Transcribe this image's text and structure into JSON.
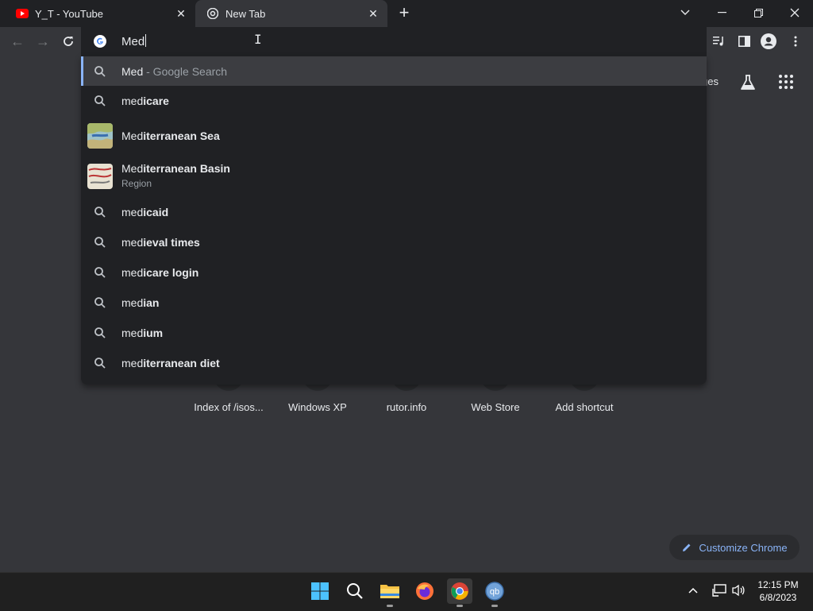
{
  "tabs": [
    {
      "title": "Y_T - YouTube",
      "icon": "youtube-icon"
    },
    {
      "title": "New Tab",
      "icon": "chrome-icon"
    }
  ],
  "omnibox": {
    "value": "Med"
  },
  "dropdown": {
    "top": {
      "match": "Med",
      "hint": " - Google Search"
    },
    "items": [
      {
        "prefix": "med",
        "suffix": "icare",
        "sub": "",
        "icon": "search-icon"
      },
      {
        "prefix": "Med",
        "suffix": "iterranean Sea",
        "sub": "",
        "icon": "map-thumbnail"
      },
      {
        "prefix": "Med",
        "suffix": "iterranean Basin",
        "sub": "Region",
        "icon": "map-thumbnail"
      },
      {
        "prefix": "med",
        "suffix": "icaid",
        "sub": "",
        "icon": "search-icon"
      },
      {
        "prefix": "med",
        "suffix": "ieval times",
        "sub": "",
        "icon": "search-icon"
      },
      {
        "prefix": "med",
        "suffix": "icare login",
        "sub": "",
        "icon": "search-icon"
      },
      {
        "prefix": "med",
        "suffix": "ian",
        "sub": "",
        "icon": "search-icon"
      },
      {
        "prefix": "med",
        "suffix": "ium",
        "sub": "",
        "icon": "search-icon"
      },
      {
        "prefix": "med",
        "suffix": "iterranean diet",
        "sub": "",
        "icon": "search-icon"
      }
    ]
  },
  "page": {
    "images_label_partial": "ges",
    "shortcuts": [
      "Index of /isos...",
      "Windows XP",
      "rutor.info",
      "Web Store",
      "Add shortcut"
    ],
    "customize_label": "Customize Chrome"
  },
  "taskbar": {
    "time": "12:15 PM",
    "date": "6/8/2023"
  },
  "colors": {
    "accent": "#8ab4f8",
    "background": "#35363a",
    "dropdown": "#202124"
  }
}
